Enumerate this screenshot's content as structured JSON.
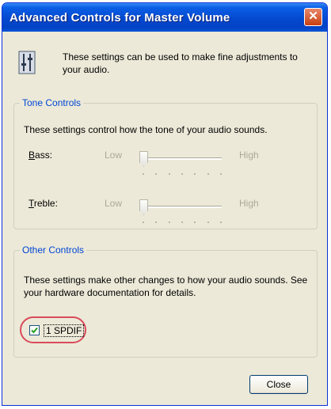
{
  "window": {
    "title": "Advanced Controls for Master Volume",
    "close_glyph": "✕",
    "title_color": "#0449cf",
    "intro_text": "These settings can be used to make fine adjustments to your audio."
  },
  "tone_controls": {
    "legend": "Tone Controls",
    "description": "These settings control how the tone of your audio sounds.",
    "bass": {
      "label_prefix": "B",
      "label_rest": "ass:",
      "low": "Low",
      "high": "High",
      "level": 0.0
    },
    "treble": {
      "label_prefix": "T",
      "label_rest": "reble:",
      "low": "Low",
      "high": "High",
      "level": 0.0
    }
  },
  "other_controls": {
    "legend": "Other Controls",
    "description": "These settings make other changes to how your audio sounds.  See your hardware documentation for details.",
    "spdif": {
      "label": "1  SPDIF",
      "checked": true
    }
  },
  "footer": {
    "close_label": "Close"
  },
  "icons": {
    "intro": "equalizer-settings-icon",
    "checkmark": "checkmark-icon"
  }
}
